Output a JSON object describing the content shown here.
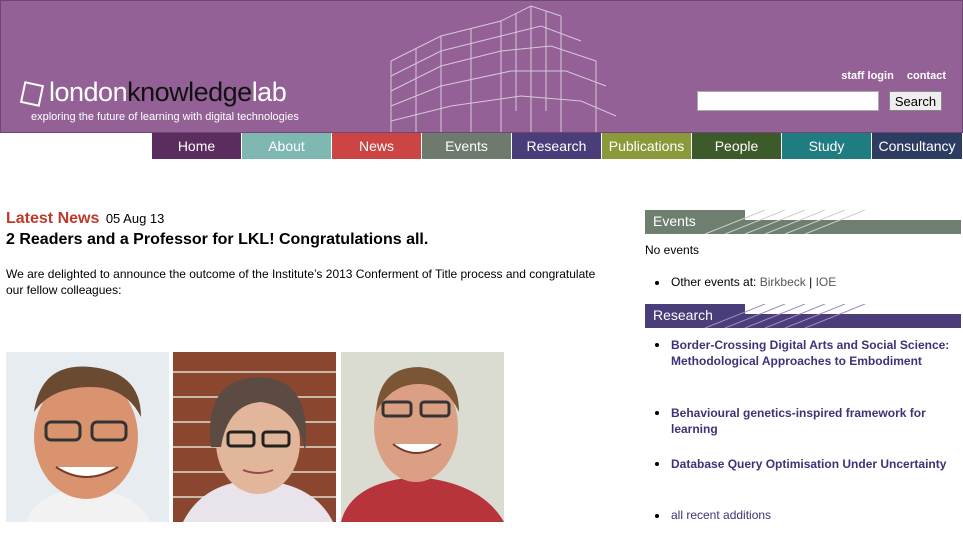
{
  "header": {
    "logo_part1": "london",
    "logo_part2": "knowledge",
    "logo_part3": "lab",
    "tagline": "exploring the future of learning with digital technologies",
    "staff_login": "staff login",
    "contact": "contact",
    "search_value": "",
    "search_button": "Search"
  },
  "nav": [
    {
      "label": "Home",
      "color": "#5b2d5e"
    },
    {
      "label": "About",
      "color": "#7fb8b2"
    },
    {
      "label": "News",
      "color": "#cc4444"
    },
    {
      "label": "Events",
      "color": "#6d7a6d"
    },
    {
      "label": "Research",
      "color": "#4a3d7a"
    },
    {
      "label": "Publications",
      "color": "#8a9a3a"
    },
    {
      "label": "People",
      "color": "#3d5a2a"
    },
    {
      "label": "Study",
      "color": "#1f7d82"
    },
    {
      "label": "Consultancy",
      "color": "#2d3d62"
    }
  ],
  "news": {
    "label": "Latest News",
    "date": "05 Aug 13",
    "headline": "2 Readers and a Professor for LKL! Congratulations all.",
    "body": "We are delighted to announce the outcome of the Institute’s 2013 Conferment of Title process and congratulate our fellow colleagues:"
  },
  "sidebar": {
    "events_title": "Events",
    "no_events": "No events",
    "other_events_label": "Other events at:",
    "birkbeck": "Birkbeck",
    "separator": "|",
    "ioe": "IOE",
    "research_title": "Research",
    "research_items": [
      "Border-Crossing Digital Arts and Social Science: Methodological Approaches to Embodiment",
      "Behavioural genetics-inspired framework for learning",
      "Database Query Optimisation Under Uncertainty"
    ],
    "all_recent": "all recent additions"
  },
  "colors": {
    "header_bg": "#946196",
    "events_head": "#6e7e6f",
    "research_head": "#4a3d7a",
    "accent_red": "#c0392b",
    "link_purple": "#3b3577"
  }
}
